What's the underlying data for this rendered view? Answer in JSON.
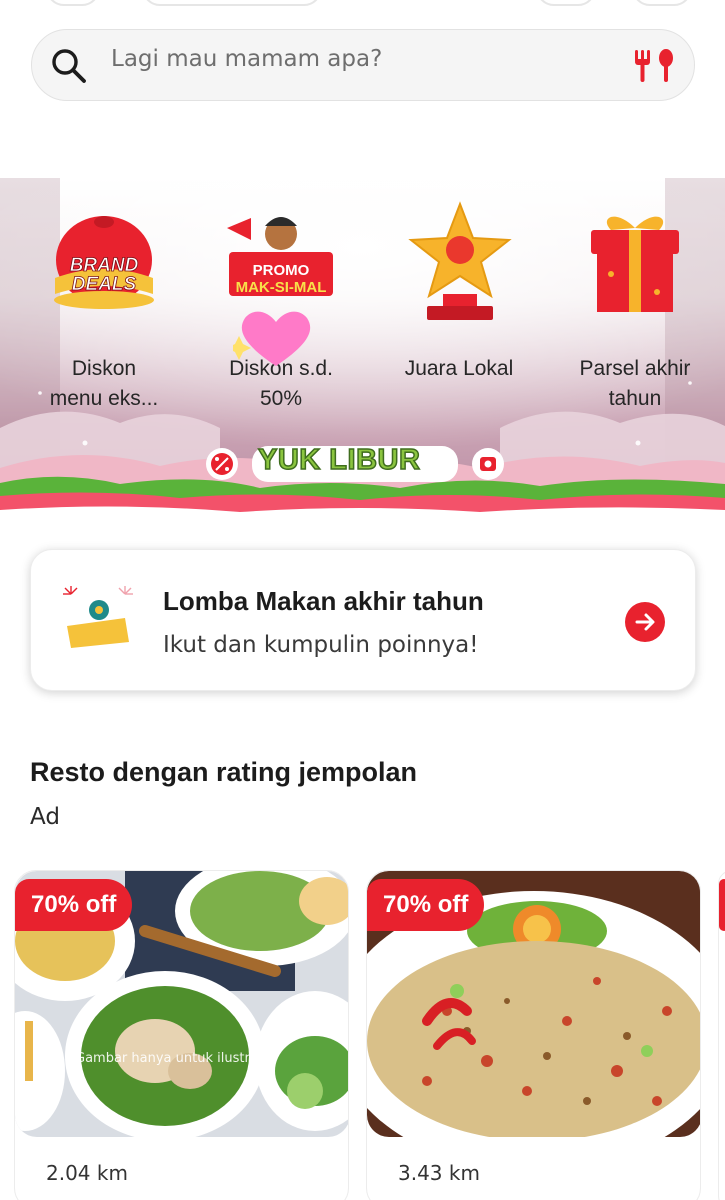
{
  "search": {
    "placeholder": "Lagi mau mamam apa?"
  },
  "categories": [
    {
      "label": "Diskon menu eks...",
      "art": "Brand Deals"
    },
    {
      "label": "Diskon s.d. 50%",
      "art": "Promo Mak-si-mal"
    },
    {
      "label": "Juara Lokal"
    },
    {
      "label": "Parsel akhir tahun"
    }
  ],
  "campaign": {
    "logo_text_1": "YUK",
    "logo_text_2": "LIBUR"
  },
  "brand_deals_art": {
    "line1": "BRAND",
    "line2": "DEALS"
  },
  "promo_art": {
    "line1": "PROMO",
    "line2": "MAK-SI-MAL"
  },
  "lomba": {
    "title": "Lomba Makan akhir tahun",
    "subtitle": "Ikut dan kumpulin poinnya!"
  },
  "section": {
    "title": "Resto dengan rating jempolan",
    "ad_label": "Ad"
  },
  "restos": [
    {
      "discount": "70% off",
      "distance": "2.04 km",
      "note": "Gambar hanya untuk ilustrasi"
    },
    {
      "discount": "70% off",
      "distance": "3.43 km"
    }
  ],
  "colors": {
    "accent": "#e8222e",
    "banner_pink": "#c78fa4",
    "green": "#5ab33a"
  }
}
